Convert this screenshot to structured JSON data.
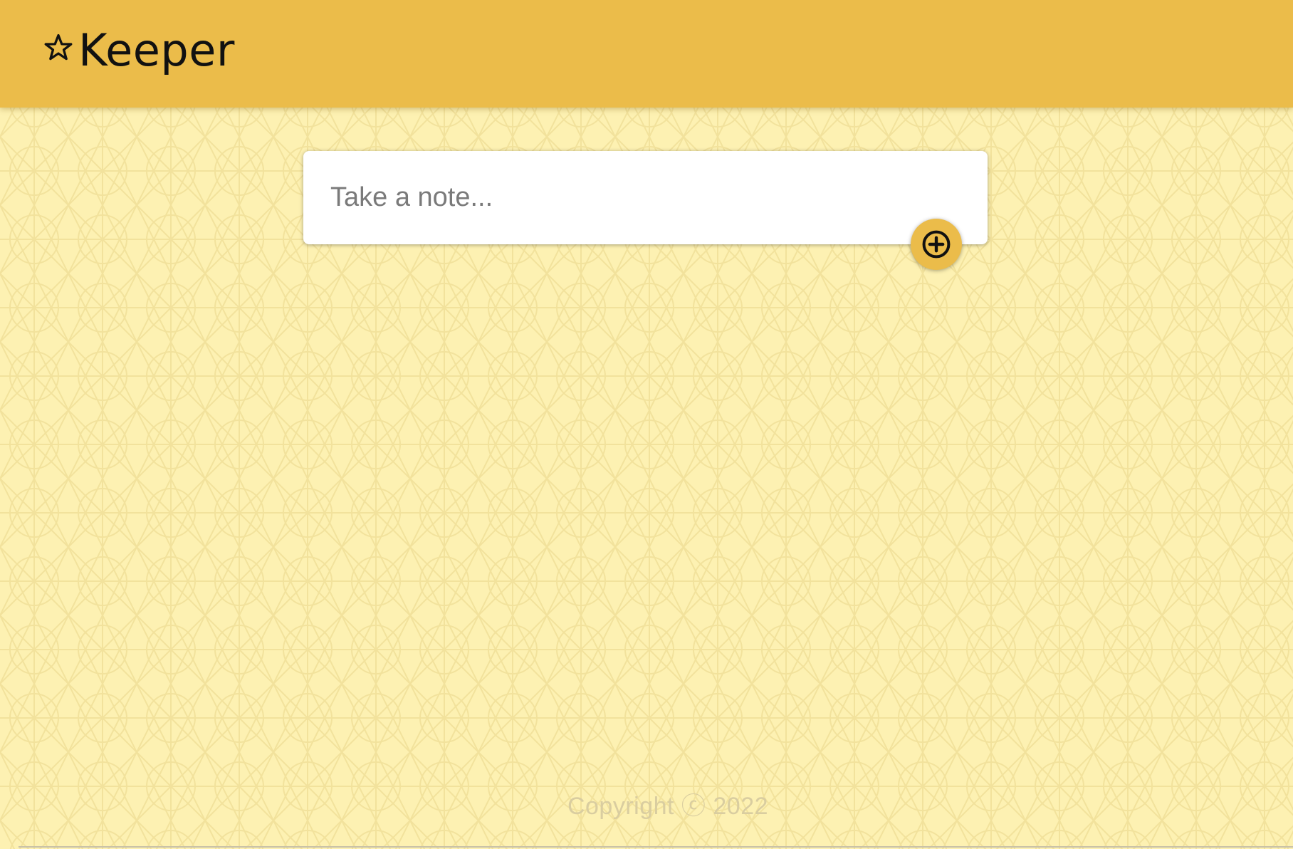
{
  "header": {
    "brand_icon": "star-outline-icon",
    "title": "Keeper"
  },
  "note_form": {
    "placeholder": "Take a note...",
    "value": "",
    "add_icon": "add-circle-icon"
  },
  "footer": {
    "copyright": "Copyright ⓒ 2022"
  },
  "colors": {
    "header_bg": "#ebbc4a",
    "page_bg": "#fdf1b2",
    "pattern_line": "#f2e29d",
    "card_bg": "#ffffff",
    "button_bg": "#ebbc4a",
    "footer_text": "#d9cda0"
  }
}
